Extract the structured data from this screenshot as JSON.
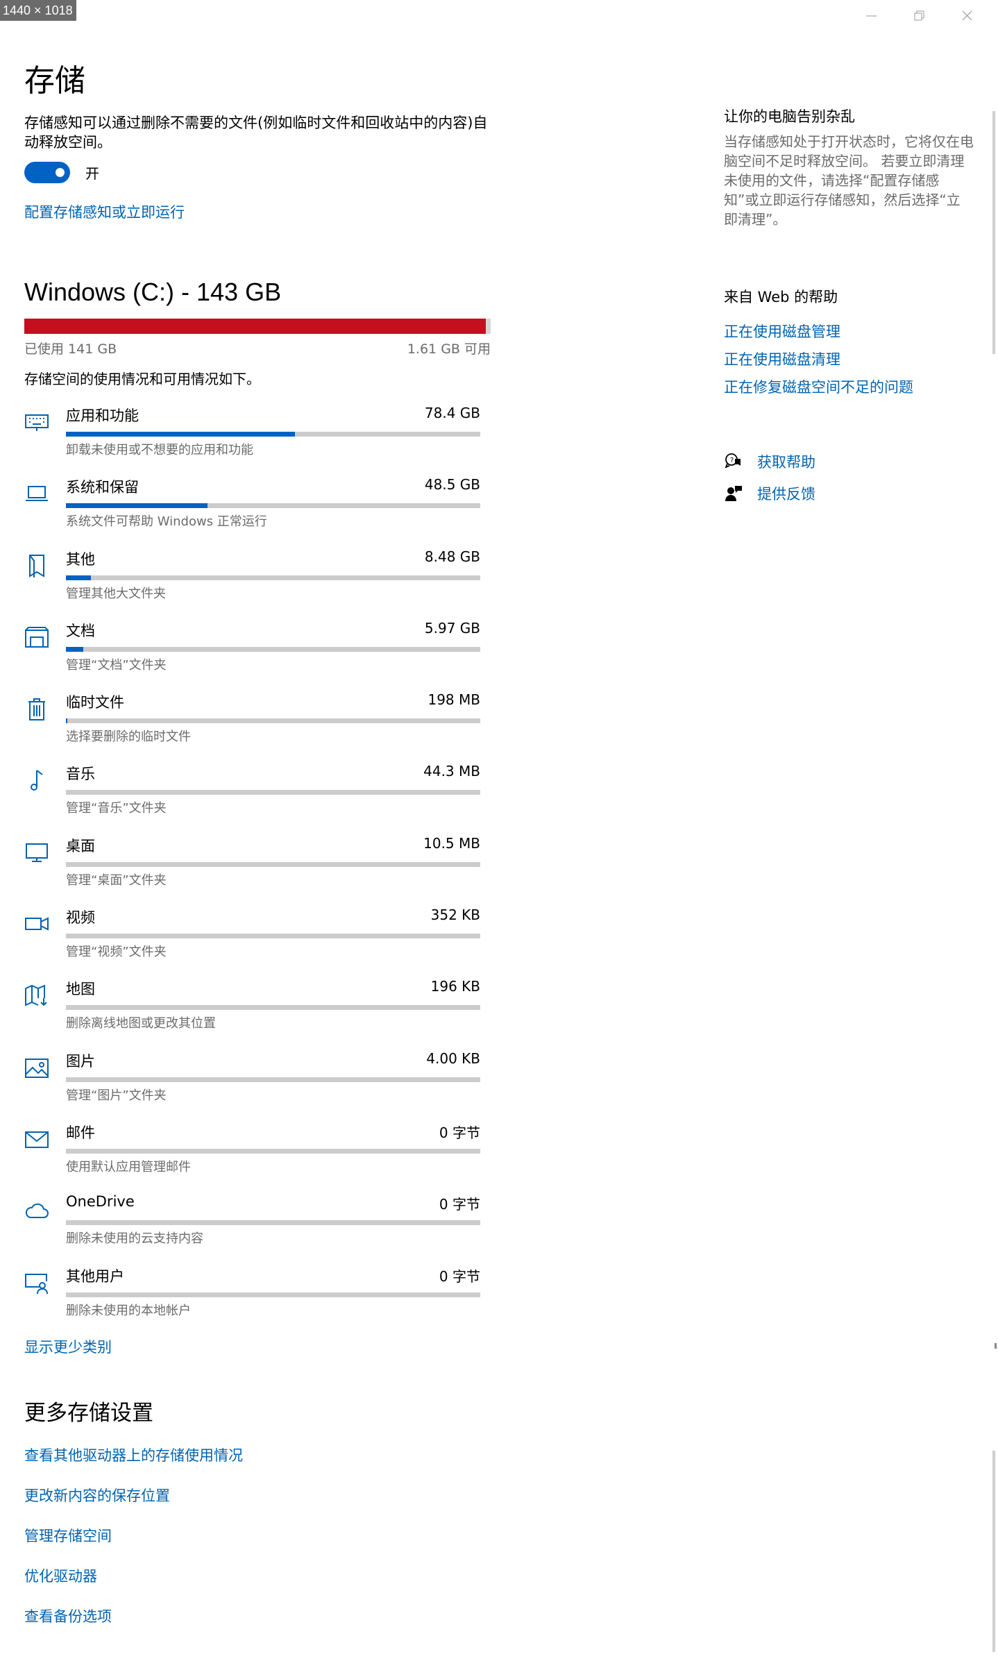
{
  "badge": "1440 × 1018",
  "page": {
    "title": "存储",
    "description": "存储感知可以通过删除不需要的文件(例如临时文件和回收站中的内容)自动释放空间。",
    "toggle_label": "开",
    "toggle_on": true,
    "configure_link": "配置存储感知或立即运行"
  },
  "drive": {
    "title": "Windows (C:) - 143 GB",
    "used": "已使用 141 GB",
    "free": "1.61 GB 可用",
    "used_fraction": 0.989,
    "description": "存储空间的使用情况和可用情况如下。",
    "bar_color": "#c50f1f"
  },
  "categories": [
    {
      "icon": "keyboard-icon",
      "name": "应用和功能",
      "size": "78.4 GB",
      "sub": "卸载未使用或不想要的应用和功能",
      "fraction": 0.552
    },
    {
      "icon": "laptop-icon",
      "name": "系统和保留",
      "size": "48.5 GB",
      "sub": "系统文件可帮助 Windows 正常运行",
      "fraction": 0.342
    },
    {
      "icon": "other-icon",
      "name": "其他",
      "size": "8.48 GB",
      "sub": "管理其他大文件夹",
      "fraction": 0.06
    },
    {
      "icon": "documents-icon",
      "name": "文档",
      "size": "5.97 GB",
      "sub": "管理“文档”文件夹",
      "fraction": 0.042
    },
    {
      "icon": "trash-icon",
      "name": "临时文件",
      "size": "198 MB",
      "sub": "选择要删除的临时文件",
      "fraction": 0.003
    },
    {
      "icon": "music-icon",
      "name": "音乐",
      "size": "44.3 MB",
      "sub": "管理“音乐”文件夹",
      "fraction": 0
    },
    {
      "icon": "desktop-icon",
      "name": "桌面",
      "size": "10.5 MB",
      "sub": "管理“桌面”文件夹",
      "fraction": 0
    },
    {
      "icon": "video-icon",
      "name": "视频",
      "size": "352 KB",
      "sub": "管理“视频”文件夹",
      "fraction": 0
    },
    {
      "icon": "map-icon",
      "name": "地图",
      "size": "196 KB",
      "sub": "删除离线地图或更改其位置",
      "fraction": 0
    },
    {
      "icon": "picture-icon",
      "name": "图片",
      "size": "4.00 KB",
      "sub": "管理“图片”文件夹",
      "fraction": 0
    },
    {
      "icon": "mail-icon",
      "name": "邮件",
      "size": "0 字节",
      "sub": "使用默认应用管理邮件",
      "fraction": 0
    },
    {
      "icon": "cloud-icon",
      "name": "OneDrive",
      "size": "0 字节",
      "sub": "删除未使用的云支持内容",
      "fraction": 0
    },
    {
      "icon": "other-users-icon",
      "name": "其他用户",
      "size": "0 字节",
      "sub": "删除未使用的本地帐户",
      "fraction": 0
    }
  ],
  "show_less": "显示更少类别",
  "more": {
    "title": "更多存储设置",
    "links": [
      "查看其他驱动器上的存储使用情况",
      "更改新内容的保存位置",
      "管理存储空间",
      "优化驱动器",
      "查看备份选项"
    ]
  },
  "side": {
    "s1_title": "让你的电脑告别杂乱",
    "s1_text": "当存储感知处于打开状态时，它将仅在电脑空间不足时释放空间。 若要立即清理未使用的文件，请选择“配置存储感知”或立即运行存储感知，然后选择“立即清理”。",
    "s2_title": "来自 Web 的帮助",
    "web_links": [
      "正在使用磁盘管理",
      "正在使用磁盘清理",
      "正在修复磁盘空间不足的问题"
    ],
    "get_help": "获取帮助",
    "feedback": "提供反馈"
  },
  "colors": {
    "accent": "#0063b1",
    "bar_fill": "#0062c4",
    "drive_bar": "#c50f1f"
  }
}
